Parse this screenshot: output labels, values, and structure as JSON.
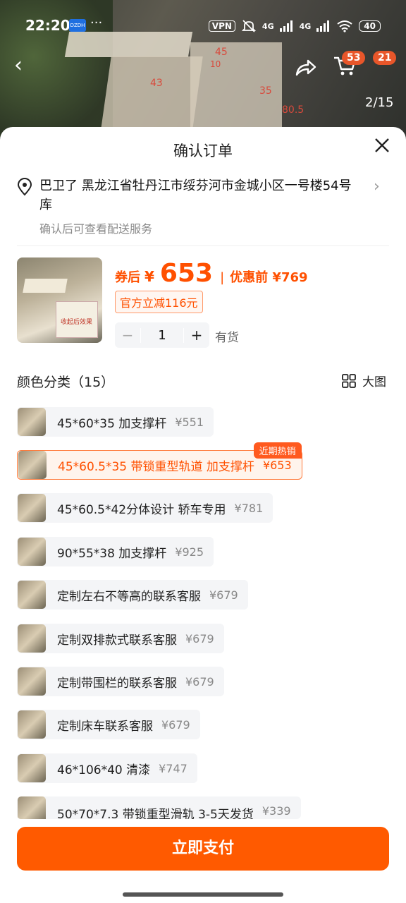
{
  "status_bar": {
    "time": "22:20",
    "app_icon_text": "DZDH",
    "more": "···",
    "vpn": "VPN",
    "signal1": "4G",
    "signal2": "4G",
    "battery": "40"
  },
  "photo": {
    "index": "2/15",
    "cart_badge": "53",
    "msg_badge": "21",
    "dimensions": [
      "45",
      "10",
      "43",
      "35",
      "80.5"
    ]
  },
  "sheet": {
    "title": "确认订单"
  },
  "address": {
    "text": "巴卫了 黑龙江省牡丹江市绥芬河市金城小区一号楼54号库",
    "sub": "确认后可查看配送服务"
  },
  "product": {
    "thumb_label": "收起后效果",
    "price_prefix": "券后",
    "price_yen": "¥",
    "price": "653",
    "price_sep": "|",
    "price_before": "优惠前 ¥769",
    "coupon": "官方立减116元",
    "quantity": "1",
    "minus": "−",
    "plus": "+",
    "stock": "有货"
  },
  "options_section": {
    "title": "颜色分类（15）",
    "big_view": "大图"
  },
  "options": [
    {
      "label": "45*60*35 加支撑杆",
      "price": "¥551"
    },
    {
      "label": "45*60.5*35 带锁重型轨道 加支撑杆",
      "price": "¥653",
      "tag": "近期热销"
    },
    {
      "label": "45*60.5*42分体设计 轿车专用",
      "price": "¥781"
    },
    {
      "label": "90*55*38 加支撑杆",
      "price": "¥925"
    },
    {
      "label": "定制左右不等高的联系客服",
      "price": "¥679"
    },
    {
      "label": "定制双排款式联系客服",
      "price": "¥679"
    },
    {
      "label": "定制带围栏的联系客服",
      "price": "¥679"
    },
    {
      "label": "定制床车联系客服",
      "price": "¥679"
    },
    {
      "label": "46*106*40 清漆",
      "price": "¥747"
    },
    {
      "label": "50*70*7.3 带锁重型滑轨 3-5天发货",
      "price": "¥339"
    }
  ],
  "pay_button": "立即支付",
  "colors": {
    "accent": "#ff5000",
    "button": "#ff5a00"
  }
}
